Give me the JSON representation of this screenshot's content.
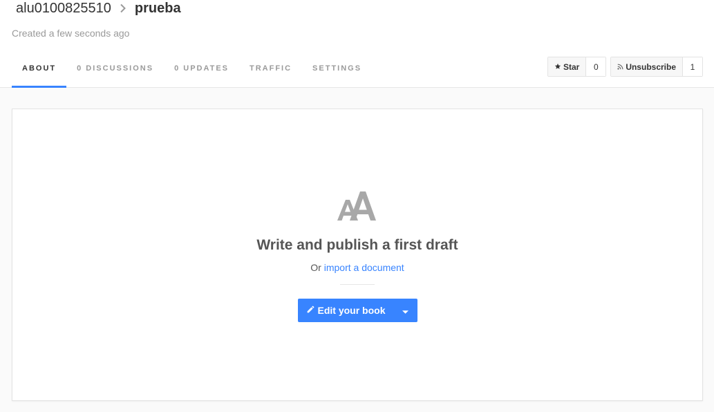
{
  "breadcrumb": {
    "owner": "alu0100825510",
    "book": "prueba",
    "separator_icon": "chevron-right-icon"
  },
  "created_text": "Created a few seconds ago",
  "tabs": [
    {
      "label": "ABOUT",
      "active": true
    },
    {
      "label": "0 DISCUSSIONS",
      "active": false
    },
    {
      "label": "0 UPDATES",
      "active": false
    },
    {
      "label": "TRAFFIC",
      "active": false
    },
    {
      "label": "SETTINGS",
      "active": false
    }
  ],
  "social": {
    "star_label": "Star",
    "star_count": "0",
    "star_icon": "star-icon",
    "subscribe_label": "Unsubscribe",
    "subscribe_count": "1",
    "subscribe_icon": "rss-icon"
  },
  "empty_state": {
    "logo_icon": "gitbook-aa-icon",
    "title": "Write and publish a first draft",
    "sub_prefix": "Or",
    "import_link": "import a document",
    "edit_label": "Edit your book",
    "edit_icon": "pencil-icon",
    "dropdown_icon": "caret-down-icon"
  },
  "colors": {
    "accent": "#3884ff",
    "muted_text": "#9a9a9a",
    "logo_gray": "#a8a8a8"
  }
}
